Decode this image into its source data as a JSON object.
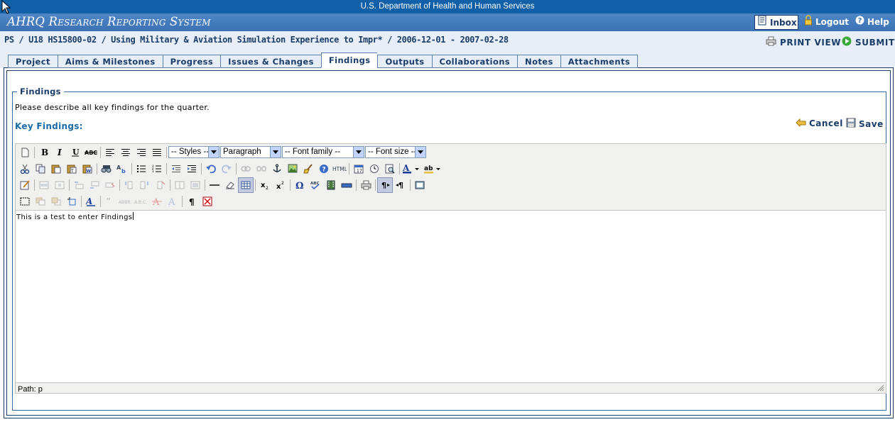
{
  "header": {
    "department": "U.S. Department of Health and Human Services",
    "system_title": "AHRQ Research Reporting System",
    "inbox_label": "Inbox",
    "logout_label": "Logout",
    "help_label": "Help"
  },
  "project": {
    "path": "PS / U18 HS15800-02 / Using Military & Aviation Simulation Experience to Impr* / 2006-12-01 - 2007-02-28",
    "print_view_label": "PRINT VIEW",
    "submit_label": "SUBMIT"
  },
  "tabs": [
    {
      "label": "Project"
    },
    {
      "label": "Aims & Milestones"
    },
    {
      "label": "Progress"
    },
    {
      "label": "Issues & Changes"
    },
    {
      "label": "Findings",
      "active": true
    },
    {
      "label": "Outputs"
    },
    {
      "label": "Collaborations"
    },
    {
      "label": "Notes"
    },
    {
      "label": "Attachments"
    }
  ],
  "findings": {
    "legend": "Findings",
    "instructions": "Please describe all key findings for the quarter.",
    "key_findings_label": "Key Findings:",
    "cancel_label": "Cancel",
    "save_label": "Save"
  },
  "editor": {
    "styles_select": "-- Styles --",
    "format_select": "Paragraph",
    "font_family_select": "-- Font family --",
    "font_size_select": "-- Font size --",
    "content": "This is a test to enter Findings",
    "status_path": "Path: p"
  },
  "colors": {
    "hhs_bar": "#1160a8",
    "system_bar": "#4579bb",
    "project_bar": "#e7eef7",
    "text_dark_blue": "#1a3d6a",
    "accent_blue": "#1a6aa8"
  }
}
